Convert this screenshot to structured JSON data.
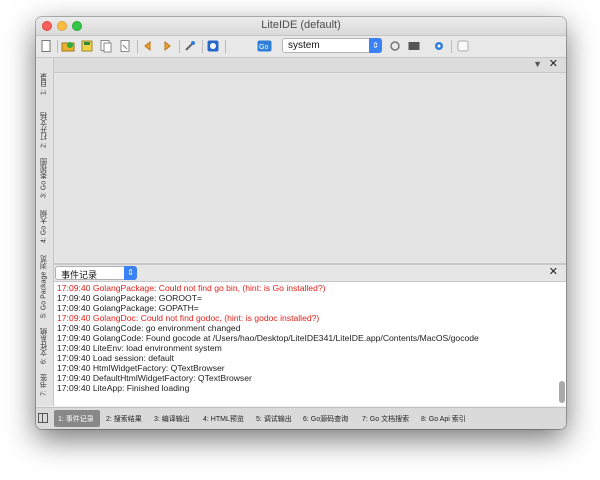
{
  "window": {
    "title": "LiteIDE (default)"
  },
  "toolbar": {
    "environment": "system",
    "icons": [
      "new-file-icon",
      "open-folder-icon",
      "save-icon",
      "save-all-icon",
      "close-file-icon",
      "back-icon",
      "forward-icon",
      "tools-icon",
      "browser-icon",
      "go-icon",
      "refresh-icon",
      "terminal-icon",
      "settings-icon",
      "blank-icon"
    ]
  },
  "sidebar": {
    "items": [
      {
        "label": "1: 目录"
      },
      {
        "label": "2: 打开文档"
      },
      {
        "label": "3: Go 类视图"
      },
      {
        "label": "4: Go 大纲"
      },
      {
        "label": "5: Go Package 浏览"
      },
      {
        "label": "6: 文件系统"
      },
      {
        "label": "7: 书签"
      }
    ]
  },
  "output": {
    "selected": "事件记录",
    "lines": [
      {
        "text": "17:09:40 GolangPackage: Could not find go bin, (hint: is Go installed?)",
        "level": "error"
      },
      {
        "text": "17:09:40 GolangPackage: GOROOT=",
        "level": "info"
      },
      {
        "text": "17:09:40 GolangPackage: GOPATH=",
        "level": "info"
      },
      {
        "text": "17:09:40 GolangDoc: Could not find godoc, (hint: is godoc installed?)",
        "level": "error"
      },
      {
        "text": "17:09:40 GolangCode: go environment changed",
        "level": "info"
      },
      {
        "text": "17:09:40 GolangCode: Found gocode at /Users/hao/Desktop/LiteIDE341/LiteIDE.app/Contents/MacOS/gocode",
        "level": "info"
      },
      {
        "text": "17:09:40 LiteEnv: load environment system",
        "level": "info"
      },
      {
        "text": "17:09:40 Load session: default",
        "level": "info"
      },
      {
        "text": "17:09:40 HtmlWidgetFactory: QTextBrowser",
        "level": "info"
      },
      {
        "text": "17:09:40 DefaultHtmlWidgetFactory: QTextBrowser",
        "level": "info"
      },
      {
        "text": "17:09:40 LiteApp: Finished loading",
        "level": "info"
      }
    ]
  },
  "bottom_tabs": [
    {
      "label": "1: 事件记录",
      "active": true
    },
    {
      "label": "2: 搜索结果",
      "active": false
    },
    {
      "label": "3: 编译输出",
      "active": false
    },
    {
      "label": "4: HTML预览",
      "active": false
    },
    {
      "label": "5: 调试输出",
      "active": false
    },
    {
      "label": "6: Go源码查询",
      "active": false
    },
    {
      "label": "7: Go 文档搜索",
      "active": false
    },
    {
      "label": "8: Go Api 索引",
      "active": false
    }
  ],
  "colors": {
    "error": "#e0221a",
    "info": "#1e1e1e",
    "accent": "#3b82f6"
  }
}
